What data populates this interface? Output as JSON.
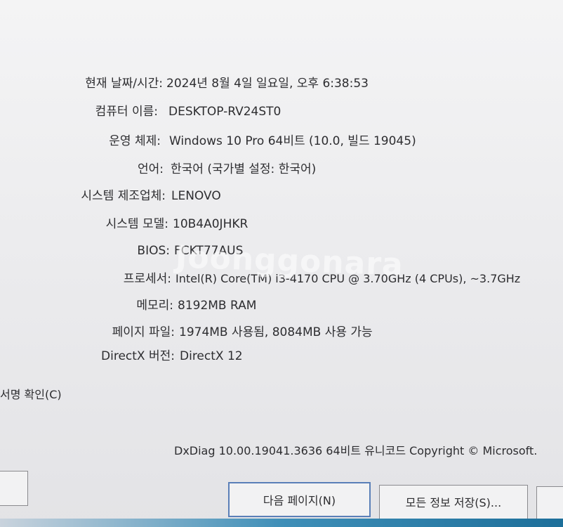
{
  "system_info": {
    "rows": [
      {
        "label": "현재 날짜/시간:",
        "value": "2024년 8월 4일 일요일, 오후 6:38:53"
      },
      {
        "label": "컴퓨터 이름:",
        "value": "DESKTOP-RV24ST0"
      },
      {
        "label": "운영 체제:",
        "value": "Windows 10 Pro 64비트 (10.0, 빌드 19045)"
      },
      {
        "label": "언어:",
        "value": "한국어 (국가별 설정: 한국어)"
      },
      {
        "label": "시스템 제조업체:",
        "value": "LENOVO"
      },
      {
        "label": "시스템 모델:",
        "value": "10B4A0JHKR"
      },
      {
        "label": "BIOS:",
        "value": "FCKT77AUS"
      },
      {
        "label": "프로세서:",
        "value": "Intel(R) Core(TM) i3-4170 CPU @ 3.70GHz (4 CPUs), ~3.7GHz"
      },
      {
        "label": "메모리:",
        "value": "8192MB RAM"
      },
      {
        "label": "페이지 파일:",
        "value": "1974MB 사용됨, 8084MB 사용 가능"
      },
      {
        "label": "DirectX 버전:",
        "value": "DirectX 12"
      }
    ]
  },
  "options": {
    "signature_check_label": "서명 확인(C)"
  },
  "footer": {
    "version_text": "DxDiag 10.00.19041.3636 64비트 유니코드  Copyright © Microsoft."
  },
  "buttons": {
    "next_page": "다음 페이지(N)",
    "save_all": "모든 정보 저장(S)..."
  },
  "watermark": {
    "text": "Joonggonara"
  }
}
